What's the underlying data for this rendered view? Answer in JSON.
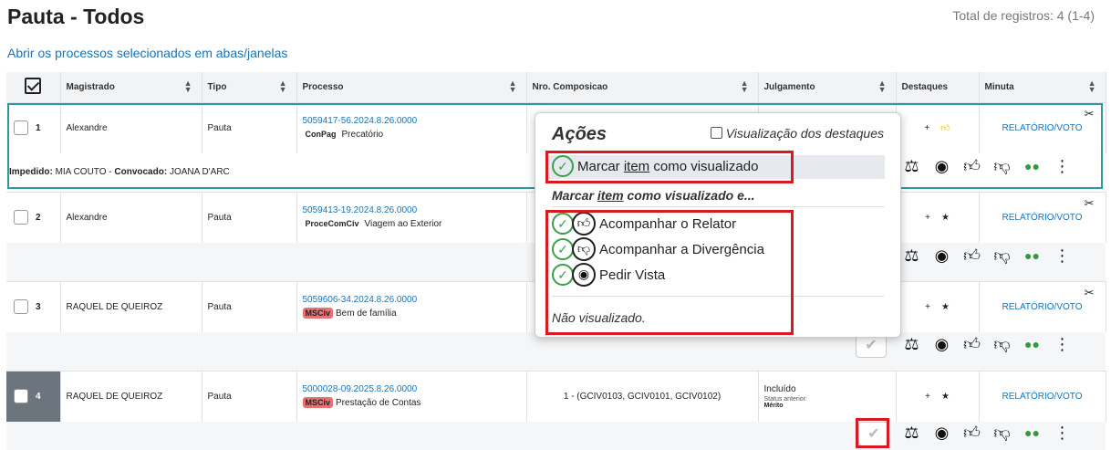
{
  "header": {
    "title": "Pauta - Todos",
    "total": "Total de registros: 4 (1-4)",
    "open_link": "Abrir os processos selecionados em abas/janelas"
  },
  "columns": [
    "Magistrado",
    "Tipo",
    "Processo",
    "Nro. Composicao",
    "Julgamento",
    "Destaques",
    "Minuta"
  ],
  "rows": [
    {
      "num": "1",
      "magistrado": "Alexandre",
      "tipo": "Pauta",
      "processo": "5059417-56.2024.8.26.0000",
      "classe": "ConPag",
      "assunto": "Precatório",
      "composicao": "",
      "julgamento": "",
      "minuta": "RELATÓRIO/VOTO"
    },
    {
      "num": "2",
      "magistrado": "Alexandre",
      "tipo": "Pauta",
      "processo": "5059413-19.2024.8.26.0000",
      "classe": "ProceComCiv",
      "assunto": "Viagem ao Exterior",
      "composicao": "",
      "julgamento": "",
      "minuta": "RELATÓRIO/VOTO"
    },
    {
      "num": "3",
      "magistrado": "RAQUEL DE QUEIROZ",
      "tipo": "Pauta",
      "processo": "5059606-34.2024.8.26.0000",
      "classe": "MSCiv",
      "assunto": "Bem de família",
      "composicao": "",
      "julgamento": "",
      "minuta": "RELATÓRIO/VOTO"
    },
    {
      "num": "4",
      "magistrado": "RAQUEL DE QUEIROZ",
      "tipo": "Pauta",
      "processo": "5000028-09.2025.8.26.0000",
      "classe": "MSCiv",
      "assunto": "Prestação de Contas",
      "composicao": "1 - (GCIV0103, GCIV0101, GCIV0102)",
      "julgamento": "Incluído",
      "status_anterior": "Status anterior:",
      "status_value": "Mérito",
      "minuta": "RELATÓRIO/VOTO"
    }
  ],
  "impedido": {
    "label1": "Impedido:",
    "value1": "MIA COUTO",
    "label2": "Convocado:",
    "value2": "JOANA D'ARC"
  },
  "popup": {
    "title": "Ações",
    "vis_label": "Visualização dos destaques",
    "mark_prefix": "Marcar",
    "mark_item": "item",
    "mark_suffix": "como visualizado",
    "mark_and_prefix": "Marcar",
    "mark_and_item": "item",
    "mark_and_suffix": "como visualizado e...",
    "follow_rapporteur": "Acompanhar o Relator",
    "follow_divergence": "Acompanhar a Divergência",
    "request_view": "Pedir Vista",
    "not_viewed": "Não visualizado."
  },
  "icons": {
    "plus": "plus-icon",
    "thumbs-up": "thumbs-up-icon",
    "star": "star-icon",
    "scissors": "scissors-icon",
    "gavel": "gavel-icon",
    "eye": "eye-icon",
    "thumbs-down": "thumbs-down-icon",
    "group": "group-icon",
    "more": "more-vert-icon",
    "check": "check-icon"
  },
  "colors": {
    "link": "#1a73b8",
    "selected_border": "#2e9aa0",
    "highlight_red": "#d71920",
    "thumb_orange": "#f5b300",
    "green": "#2e9c3c",
    "tag_red": "#e57373"
  }
}
